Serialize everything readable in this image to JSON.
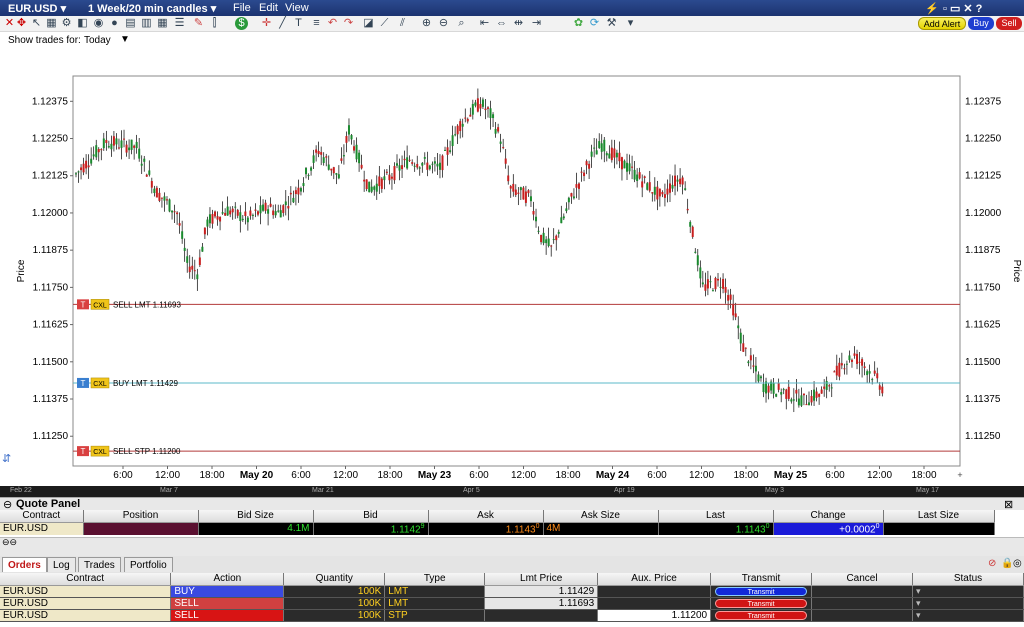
{
  "titlebar": {
    "symbol": "EUR.USD",
    "period": "1 Week/20 min candles",
    "menus": [
      "File",
      "Edit",
      "View"
    ]
  },
  "header_buttons": {
    "add_alert": "Add Alert",
    "buy": "Buy",
    "sell": "Sell"
  },
  "show_trades": {
    "label": "Show trades for:",
    "value": "Today"
  },
  "chart_data": {
    "type": "candlestick",
    "ylabel": "Price",
    "ylim": [
      1.1115,
      1.1246
    ],
    "y_ticks": [
      "1.12375",
      "1.12250",
      "1.12125",
      "1.12000",
      "1.11875",
      "1.11750",
      "1.11625",
      "1.11500",
      "1.11375",
      "1.11250"
    ],
    "y_tick_values": [
      1.12375,
      1.1225,
      1.12125,
      1.12,
      1.11875,
      1.1175,
      1.11625,
      1.115,
      1.11375,
      1.1125
    ],
    "x_ticks": [
      {
        "label": "6:00",
        "bold": false
      },
      {
        "label": "12:00",
        "bold": false
      },
      {
        "label": "18:00",
        "bold": false
      },
      {
        "label": "May 20",
        "bold": true
      },
      {
        "label": "6:00",
        "bold": false
      },
      {
        "label": "12:00",
        "bold": false
      },
      {
        "label": "18:00",
        "bold": false
      },
      {
        "label": "May 23",
        "bold": true
      },
      {
        "label": "6:00",
        "bold": false
      },
      {
        "label": "12:00",
        "bold": false
      },
      {
        "label": "18:00",
        "bold": false
      },
      {
        "label": "May 24",
        "bold": true
      },
      {
        "label": "6:00",
        "bold": false
      },
      {
        "label": "12:00",
        "bold": false
      },
      {
        "label": "18:00",
        "bold": false
      },
      {
        "label": "May 25",
        "bold": true
      },
      {
        "label": "6:00",
        "bold": false
      },
      {
        "label": "12:00",
        "bold": false
      },
      {
        "label": "18:00",
        "bold": false
      }
    ],
    "close_path": [
      [
        0,
        1.1213
      ],
      [
        3,
        1.1224
      ],
      [
        6,
        1.1222
      ],
      [
        8,
        1.1207
      ],
      [
        10,
        1.12
      ],
      [
        11,
        1.1183
      ],
      [
        12,
        1.118
      ],
      [
        13,
        1.1197
      ],
      [
        15,
        1.1201
      ],
      [
        17,
        1.1198
      ],
      [
        19,
        1.1202
      ],
      [
        20,
        1.12
      ],
      [
        22,
        1.1208
      ],
      [
        24,
        1.1221
      ],
      [
        26,
        1.1212
      ],
      [
        27,
        1.1228
      ],
      [
        29,
        1.1208
      ],
      [
        31,
        1.1212
      ],
      [
        33,
        1.1218
      ],
      [
        35,
        1.1216
      ],
      [
        36,
        1.1215
      ],
      [
        38,
        1.123
      ],
      [
        40,
        1.1237
      ],
      [
        41,
        1.1233
      ],
      [
        42,
        1.1225
      ],
      [
        43,
        1.1208
      ],
      [
        45,
        1.1205
      ],
      [
        46,
        1.1192
      ],
      [
        47,
        1.1188
      ],
      [
        49,
        1.1205
      ],
      [
        51,
        1.1219
      ],
      [
        52,
        1.1223
      ],
      [
        54,
        1.1217
      ],
      [
        56,
        1.1211
      ],
      [
        58,
        1.1205
      ],
      [
        59,
        1.121
      ],
      [
        60,
        1.1212
      ],
      [
        61,
        1.1193
      ],
      [
        62,
        1.1175
      ],
      [
        64,
        1.1177
      ],
      [
        65,
        1.1168
      ],
      [
        66,
        1.1155
      ],
      [
        67,
        1.1148
      ],
      [
        68,
        1.1142
      ],
      [
        70,
        1.114
      ],
      [
        72,
        1.1137
      ],
      [
        74,
        1.114
      ],
      [
        75,
        1.1145
      ],
      [
        76,
        1.115
      ],
      [
        77,
        1.1152
      ],
      [
        79,
        1.1145
      ],
      [
        80,
        1.114
      ]
    ],
    "orders": [
      {
        "tag": "T",
        "cancel": "CXL",
        "label": "SELL LMT 1.11693",
        "price": 1.11693,
        "color": "#b23a3a",
        "tcolor": "#d94040"
      },
      {
        "tag": "T",
        "cancel": "CXL",
        "label": "BUY LMT 1.11429",
        "price": 1.11429,
        "color": "#5bb8c8",
        "tcolor": "#3a7fd0"
      },
      {
        "tag": "T",
        "cancel": "CXL",
        "label": "SELL STP 1.11200",
        "price": 1.112,
        "color": "#b23a3a",
        "tcolor": "#d94040"
      }
    ],
    "colors": {
      "up": "#1a8a2e",
      "down": "#c81e1e"
    }
  },
  "nav_strip": [
    "Feb 22",
    "Mar 7",
    "Mar 21",
    "Apr 5",
    "Apr 19",
    "May 3",
    "May 17"
  ],
  "quote_panel": {
    "title": "Quote Panel",
    "headers": [
      "Contract",
      "Position",
      "Bid Size",
      "Bid",
      "Ask",
      "Ask Size",
      "Last",
      "Change",
      "Last Size"
    ],
    "row": {
      "contract": "EUR.USD",
      "position": "",
      "bid_size": "4.1M",
      "bid": "1.1142",
      "bid_sup": "9",
      "ask": "1.1143",
      "ask_sup": "0",
      "ask_size": "4M",
      "last": "1.1143",
      "last_sup": "0",
      "change": "+0.0002",
      "change_sup": "0",
      "last_size": ""
    }
  },
  "orders_panel": {
    "tabs": [
      "Orders",
      "Log",
      "Trades",
      "Portfolio"
    ],
    "headers": [
      "Contract",
      "Action",
      "Quantity",
      "Type",
      "Lmt Price",
      "Aux. Price",
      "Transmit",
      "Cancel",
      "Status"
    ],
    "rows": [
      {
        "contract": "EUR.USD",
        "action": "BUY",
        "quantity": "100K",
        "type": "LMT",
        "lmt": "1.11429",
        "aux": "",
        "transmit": "Transmit"
      },
      {
        "contract": "EUR.USD",
        "action": "SELL",
        "quantity": "100K",
        "type": "LMT",
        "lmt": "1.11693",
        "aux": "",
        "transmit": "Transmit"
      },
      {
        "contract": "EUR.USD",
        "action": "SELL",
        "quantity": "100K",
        "type": "STP",
        "lmt": "",
        "aux": "1.11200",
        "transmit": "Transmit"
      }
    ]
  }
}
